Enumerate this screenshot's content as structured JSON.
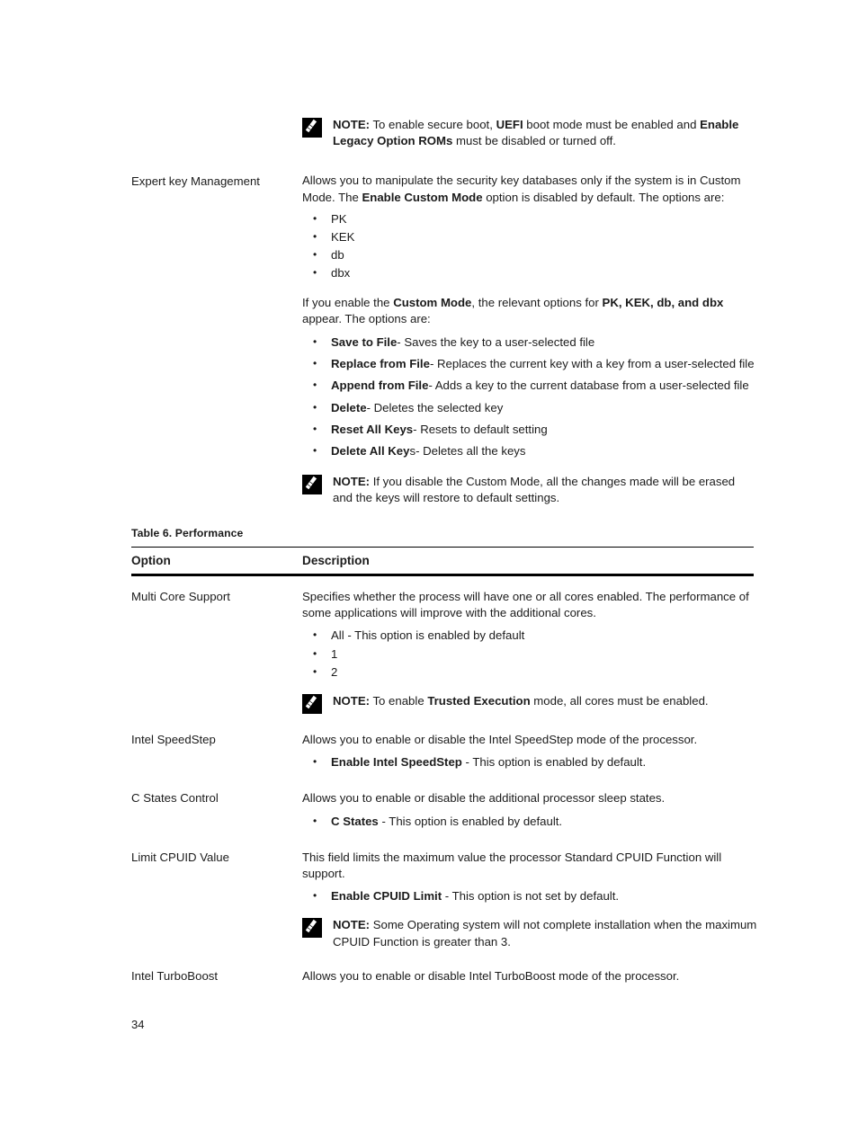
{
  "document": {
    "page_number": "34"
  },
  "secure_boot_section": {
    "top_note": {
      "icon": "note-pencil-icon",
      "label": "NOTE:",
      "segments": [
        {
          "text": " To enable secure boot, ",
          "bold": false
        },
        {
          "text": "UEFI",
          "bold": true
        },
        {
          "text": " boot mode must be enabled and ",
          "bold": false
        },
        {
          "text": "Enable Legacy Option ROMs",
          "bold": true
        },
        {
          "text": " must be disabled or turned off.",
          "bold": false
        }
      ]
    },
    "option_label": "Expert key Management",
    "description_segments": [
      {
        "text": "Allows you to manipulate the security key databases only if the system is in Custom Mode. The ",
        "bold": false
      },
      {
        "text": "Enable Custom Mode",
        "bold": true
      },
      {
        "text": " option is disabled by default. The options are:",
        "bold": false
      }
    ],
    "key_databases": [
      "PK",
      "KEK",
      "db",
      "dbx"
    ],
    "custom_mode_paragraph_segments": [
      {
        "text": "If you enable the ",
        "bold": false
      },
      {
        "text": "Custom Mode",
        "bold": true
      },
      {
        "text": ", the relevant options for ",
        "bold": false
      },
      {
        "text": "PK, KEK, db, and dbx",
        "bold": true
      },
      {
        "text": " appear. The options are:",
        "bold": false
      }
    ],
    "custom_mode_options": [
      {
        "term": "Save to File",
        "rest": "- Saves the key to a user-selected file"
      },
      {
        "term": "Replace from File",
        "rest": "- Replaces the current key with a key from a user-selected file"
      },
      {
        "term": "Append from File",
        "rest": "- Adds a key to the current database from a user-selected file"
      },
      {
        "term": "Delete",
        "rest": "- Deletes the selected key"
      },
      {
        "term": "Reset All Keys",
        "rest": "- Resets to default setting"
      },
      {
        "term": "Delete All Key",
        "rest": "s- Deletes all the keys"
      }
    ],
    "bottom_note": {
      "icon": "note-pencil-icon",
      "label": "NOTE:",
      "segments": [
        {
          "text": " If you disable the Custom Mode, all the changes made will be erased and the keys will restore to default settings.",
          "bold": false
        }
      ]
    }
  },
  "performance_table": {
    "caption": "Table 6. Performance",
    "columns": [
      "Option",
      "Description"
    ],
    "rows": [
      {
        "option": "Multi Core Support",
        "description_segments": [
          {
            "text": "Specifies whether the process will have one or all cores enabled. The performance of some applications will improve with the additional cores.",
            "bold": false
          }
        ],
        "bullets": [
          {
            "term": "",
            "rest": "All - This option is enabled by default"
          },
          {
            "term": "",
            "rest": "1"
          },
          {
            "term": "",
            "rest": "2"
          }
        ],
        "note": {
          "icon": "note-pencil-icon",
          "label": "NOTE:",
          "segments": [
            {
              "text": " To enable ",
              "bold": false
            },
            {
              "text": "Trusted Execution",
              "bold": true
            },
            {
              "text": " mode, all cores must be enabled.",
              "bold": false
            }
          ]
        }
      },
      {
        "option": "Intel SpeedStep",
        "description_segments": [
          {
            "text": "Allows you to enable or disable the Intel SpeedStep mode of the processor.",
            "bold": false
          }
        ],
        "bullets": [
          {
            "term": "Enable Intel SpeedStep",
            "rest": " - This option is enabled by default."
          }
        ],
        "note": null
      },
      {
        "option": "C States Control",
        "description_segments": [
          {
            "text": "Allows you to enable or disable the additional processor sleep states.",
            "bold": false
          }
        ],
        "bullets": [
          {
            "term": "C States",
            "rest": " - This option is enabled by default."
          }
        ],
        "note": null
      },
      {
        "option": "Limit CPUID Value",
        "description_segments": [
          {
            "text": "This field limits the maximum value the processor Standard CPUID Function will support.",
            "bold": false
          }
        ],
        "bullets": [
          {
            "term": "Enable CPUID Limit",
            "rest": " - This option is not set by default."
          }
        ],
        "note": {
          "icon": "note-pencil-icon",
          "label": "NOTE:",
          "segments": [
            {
              "text": " Some Operating system will not complete installation when the maximum CPUID Function is greater than 3.",
              "bold": false
            }
          ]
        }
      },
      {
        "option": "Intel TurboBoost",
        "description_segments": [
          {
            "text": "Allows you to enable or disable Intel TurboBoost mode of the processor.",
            "bold": false
          }
        ],
        "bullets": [],
        "note": null
      }
    ]
  }
}
